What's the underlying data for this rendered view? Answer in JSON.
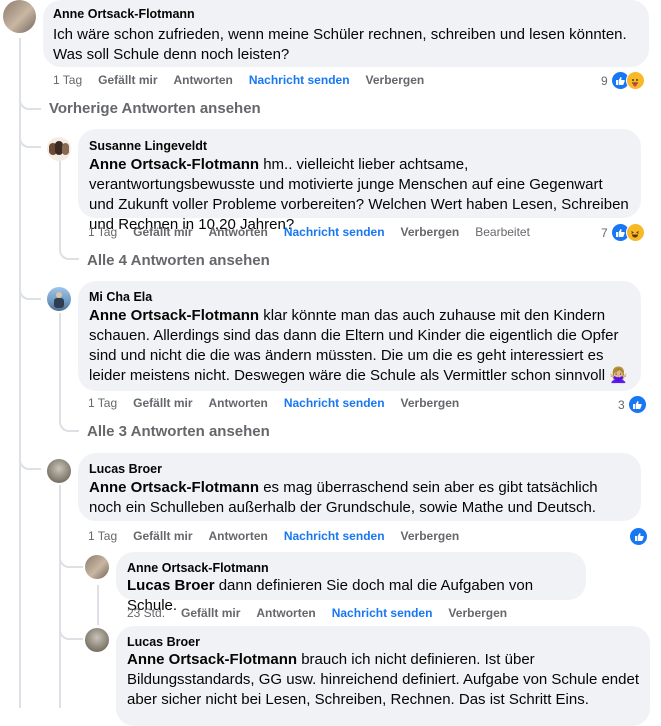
{
  "comments": [
    {
      "author": "Anne Ortsack-Flotmann",
      "text": "Ich wäre schon zufrieden, wenn meine Schüler rechnen, schreiben und lesen könnten. Was soll Schule denn noch leisten?",
      "time": "1 Tag",
      "like": "Gefällt mir",
      "reply": "Antworten",
      "send": "Nachricht senden",
      "hide": "Verbergen",
      "reactions": "9"
    },
    {
      "author": "Susanne Lingeveldt",
      "mention": "Anne Ortsack-Flotmann",
      "text": " hm.. vielleicht lieber achtsame, verantwortungsbewusste und motivierte junge Menschen auf eine Gegenwart und Zukunft voller Probleme vorbereiten? Welchen Wert haben Lesen, Schreiben und Rechnen in 10,20 Jahren?",
      "time": "1 Tag",
      "like": "Gefällt mir",
      "reply": "Antworten",
      "send": "Nachricht senden",
      "hide": "Verbergen",
      "edited": "Bearbeitet",
      "reactions": "7",
      "view_more": "Alle 4 Antworten ansehen"
    },
    {
      "author": "Mi Cha Ela",
      "mention": "Anne Ortsack-Flotmann",
      "text": " klar könnte man das auch zuhause mit den Kindern schauen. Allerdings sind das dann die Eltern und Kinder die eigentlich die Opfer sind und nicht die die was ändern müssten. Die um die es geht interessiert es leider meistens nicht. Deswegen wäre die Schule als Vermittler schon sinnvoll 🙅🏼‍♀️",
      "time": "1 Tag",
      "like": "Gefällt mir",
      "reply": "Antworten",
      "send": "Nachricht senden",
      "hide": "Verbergen",
      "reactions": "3",
      "view_more": "Alle 3 Antworten ansehen"
    },
    {
      "author": "Lucas Broer",
      "mention": "Anne Ortsack-Flotmann",
      "text": " es mag überraschend sein aber es gibt tatsächlich noch ein Schulleben außerhalb der Grundschule, sowie Mathe und Deutsch.",
      "time": "1 Tag",
      "like": "Gefällt mir",
      "reply": "Antworten",
      "send": "Nachricht senden",
      "hide": "Verbergen"
    },
    {
      "author": "Anne Ortsack-Flotmann",
      "mention": "Lucas Broer",
      "text": " dann definieren Sie doch mal die Aufgaben von Schule.",
      "time": "23 Std.",
      "like": "Gefällt mir",
      "reply": "Antworten",
      "send": "Nachricht senden",
      "hide": "Verbergen"
    },
    {
      "author": "Lucas Broer",
      "mention": "Anne Ortsack-Flotmann",
      "text": " brauch ich nicht definieren. Ist über Bildungsstandards, GG usw. hinreichend definiert. Aufgabe von Schule endet aber sicher nicht bei Lesen, Schreiben, Rechnen. Das ist Schritt Eins."
    }
  ],
  "previous_replies": "Vorherige Antworten ansehen",
  "icons": {
    "like": "like-icon",
    "haha": "haha-emoji-icon",
    "care": "care-emoji-icon"
  },
  "colors": {
    "link": "#1877f2",
    "bubble": "#f0f2f5",
    "meta": "#65676b"
  }
}
